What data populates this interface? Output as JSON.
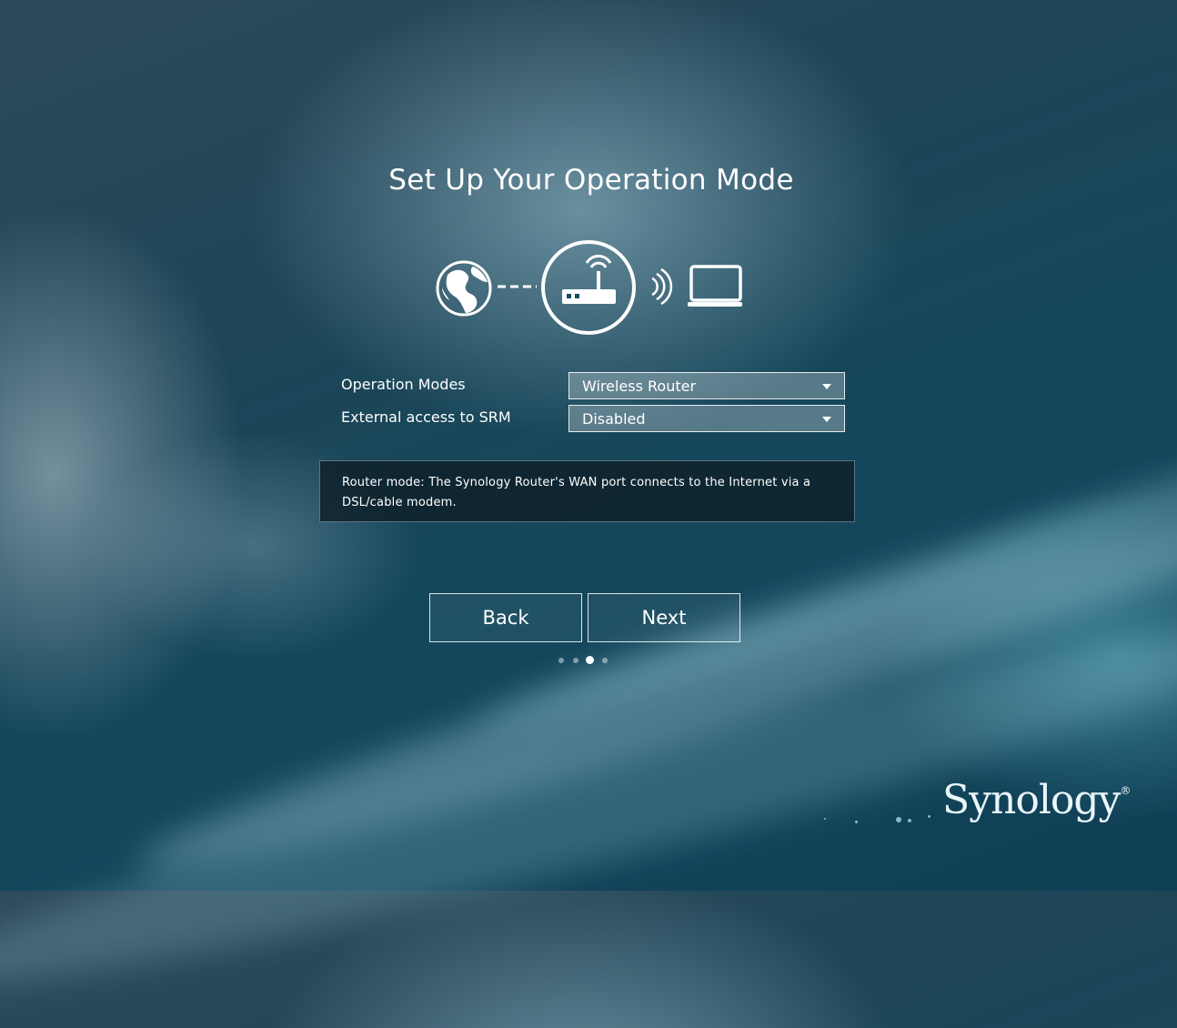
{
  "title": "Set Up Your Operation Mode",
  "form": {
    "operation_modes_label": "Operation Modes",
    "operation_modes_value": "Wireless Router",
    "external_access_label": "External access to SRM",
    "external_access_value": "Disabled"
  },
  "info_text": "Router mode: The Synology Router's WAN port connects to the Internet via a DSL/cable modem.",
  "buttons": {
    "back": "Back",
    "next": "Next"
  },
  "pagination": {
    "total_steps": 4,
    "current_step": 3
  },
  "brand": {
    "logo_text": "Synology",
    "logo_mark": "®"
  },
  "icons": [
    "globe-icon",
    "router-icon",
    "wifi-signal-icon",
    "laptop-icon"
  ],
  "colors": {
    "text": "#ffffff",
    "info_background": "#0e202a",
    "background_dark": "#14475c"
  }
}
